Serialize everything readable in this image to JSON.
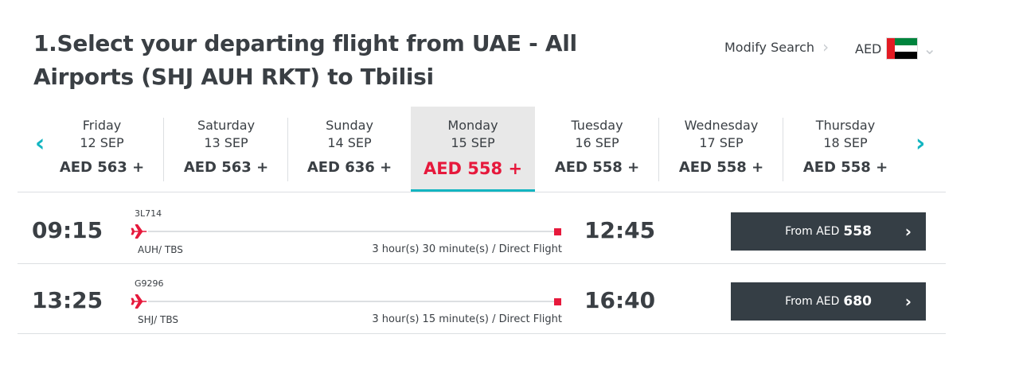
{
  "header": {
    "title": "1.Select your departing flight from UAE - All Airports (SHJ AUH RKT) to Tbilisi",
    "modify_label": "Modify Search",
    "currency": "AED"
  },
  "date_strip": {
    "days": [
      {
        "name": "Friday",
        "date": "12 SEP",
        "price": "AED 563 +",
        "selected": false
      },
      {
        "name": "Saturday",
        "date": "13 SEP",
        "price": "AED 563 +",
        "selected": false
      },
      {
        "name": "Sunday",
        "date": "14 SEP",
        "price": "AED 636 +",
        "selected": false
      },
      {
        "name": "Monday",
        "date": "15 SEP",
        "price": "AED 558 +",
        "selected": true
      },
      {
        "name": "Tuesday",
        "date": "16 SEP",
        "price": "AED 558 +",
        "selected": false
      },
      {
        "name": "Wednesday",
        "date": "17 SEP",
        "price": "AED 558 +",
        "selected": false
      },
      {
        "name": "Thursday",
        "date": "18 SEP",
        "price": "AED 558 +",
        "selected": false
      }
    ]
  },
  "flights": [
    {
      "departure": "09:15",
      "arrival": "12:45",
      "flight_no": "3L714",
      "route": "AUH/ TBS",
      "duration": "3 hour(s) 30 minute(s) / Direct Flight",
      "from_label": "From AED",
      "price": "558"
    },
    {
      "departure": "13:25",
      "arrival": "16:40",
      "flight_no": "G9296",
      "route": "SHJ/ TBS",
      "duration": "3 hour(s) 15 minute(s) / Direct Flight",
      "from_label": "From AED",
      "price": "680"
    }
  ],
  "colors": {
    "accent": "#13b5c1",
    "price_highlight": "#e6193c",
    "button_bg": "#353e45",
    "selected_day_bg": "#e8e8e8"
  }
}
